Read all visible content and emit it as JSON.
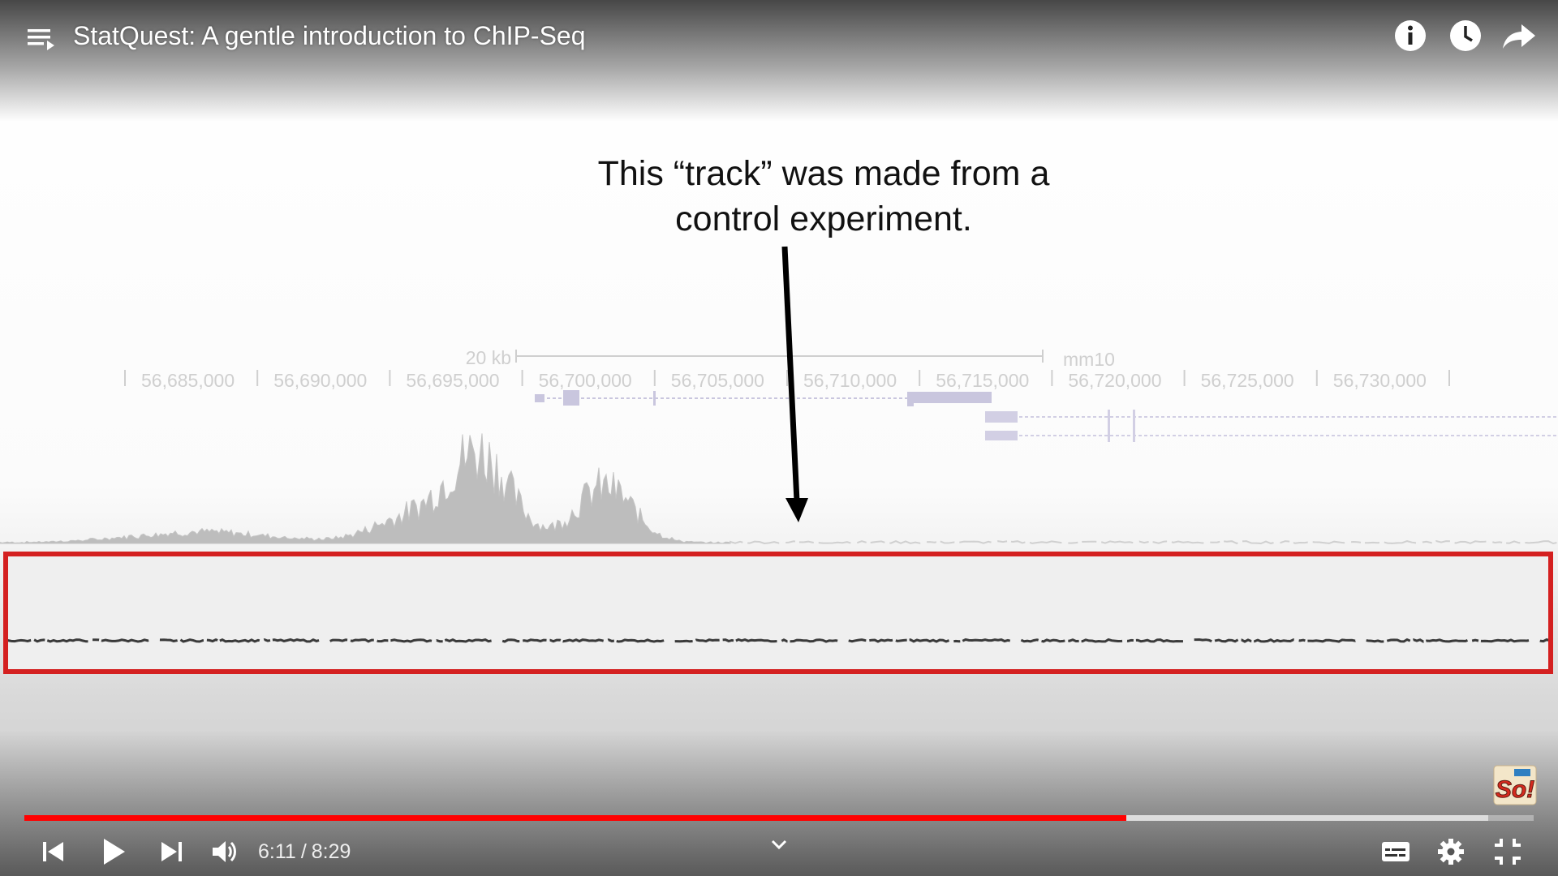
{
  "player": {
    "title": "StatQuest: A gentle introduction to ChIP-Seq",
    "top_icons": [
      "playlist-icon",
      "info-icon",
      "watch-later-icon",
      "share-icon"
    ],
    "time_current": "6:11",
    "time_separator": "/",
    "time_total": "8:29",
    "progress_played_fraction": 0.73,
    "progress_buffered_fraction": 0.97,
    "progress_color": "#ff0000",
    "control_icons": [
      "previous-icon",
      "play-icon",
      "next-icon",
      "volume-icon",
      "chevron-down-icon",
      "subtitles-icon",
      "settings-icon",
      "exit-fullscreen-icon"
    ]
  },
  "slide": {
    "annotation_lines": [
      "This “track” was made from a",
      "control experiment."
    ],
    "scale_label": "20 kb",
    "assembly_label": "mm10",
    "coordinates": [
      "56,685,000",
      "56,690,000",
      "56,695,000",
      "56,700,000",
      "56,705,000",
      "56,710,000",
      "56,715,000",
      "56,720,000",
      "56,725,000",
      "56,730,000"
    ],
    "highlight_color": "#d42020"
  },
  "watermark": {
    "text": "So!"
  }
}
